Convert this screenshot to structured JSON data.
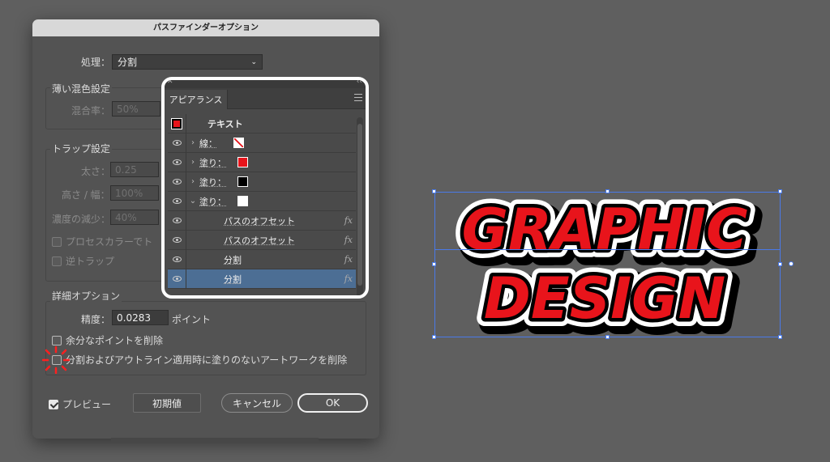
{
  "dialog": {
    "title": "パスファインダーオプション",
    "process_label": "処理：",
    "process_value": "分割",
    "blend_group": {
      "title": "薄い混色設定",
      "rate_label": "混合率：",
      "rate_value": "50%"
    },
    "trap_group": {
      "title": "トラップ設定",
      "thickness_label": "太さ：",
      "thickness_value": "0.25",
      "height_width_label": "高さ / 幅：",
      "height_width_value": "100%",
      "density_label": "濃度の減少：",
      "density_value": "40%",
      "process_color_label": "プロセスカラーでト",
      "reverse_trap_label": "逆トラップ"
    },
    "detail_group": {
      "title": "詳細オプション",
      "precision_label": "精度：",
      "precision_value": "0.0283",
      "precision_unit": "ポイント",
      "remove_redundant_label": "余分なポイントを削除",
      "remove_unpainted_label": "分割およびアウトライン適用時に塗りのないアートワークを削除"
    },
    "preview_label": "プレビュー",
    "preview_checked": true,
    "reset_button": "初期値",
    "cancel_button": "キャンセル",
    "ok_button": "OK"
  },
  "appearance_panel": {
    "tab_label": "アピアランス",
    "rows": [
      {
        "label": "テキスト",
        "type": "header"
      },
      {
        "label": "線：",
        "type": "stroke",
        "swatch": "none"
      },
      {
        "label": "塗り：",
        "type": "fill",
        "swatch": "#e8141b"
      },
      {
        "label": "塗り：",
        "type": "fill",
        "swatch": "#000000"
      },
      {
        "label": "塗り：",
        "type": "fill-open",
        "swatch": "#ffffff"
      },
      {
        "label": "パスのオフセット",
        "type": "effect",
        "fx": "fx"
      },
      {
        "label": "パスのオフセット",
        "type": "effect",
        "fx": "fx"
      },
      {
        "label": "分割",
        "type": "effect",
        "fx": "fx"
      },
      {
        "label": "分割",
        "type": "effect-selected",
        "fx": "fx"
      }
    ]
  },
  "artwork": {
    "line1": "GRAPHIC",
    "line2": "DESIGN",
    "fill_color": "#e8141b",
    "inner_stroke": "#000000",
    "outer_stroke": "#ffffff"
  }
}
